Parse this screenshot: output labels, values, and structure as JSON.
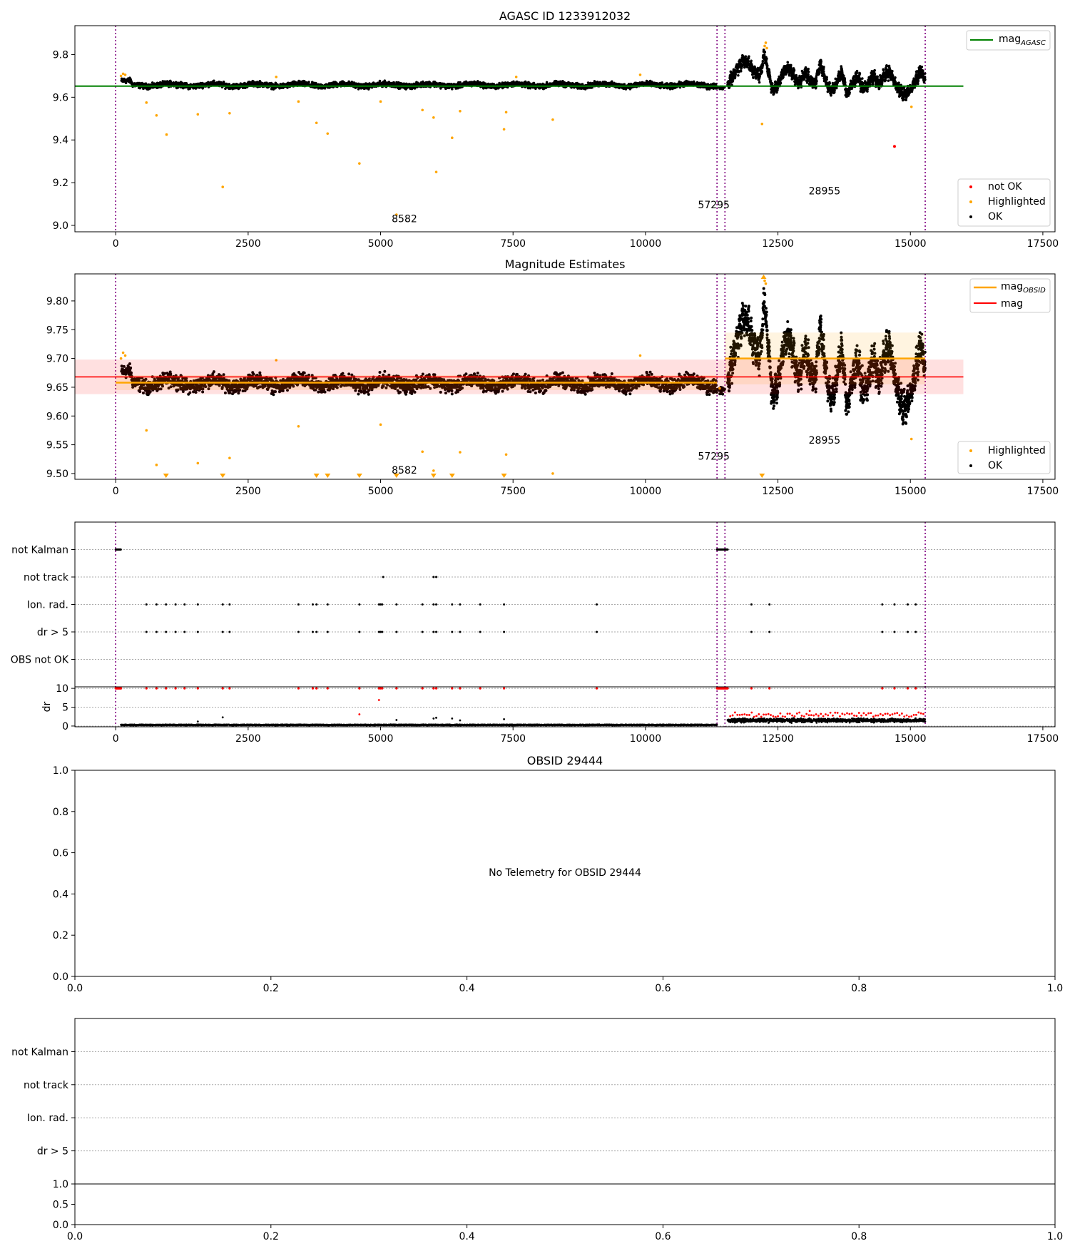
{
  "chart_data": [
    {
      "type": "scatter",
      "title": "AGASC ID 1233912032",
      "xlim": [
        -770,
        17730
      ],
      "ylim": [
        8.97,
        9.935
      ],
      "xticks": [
        0,
        2500,
        5000,
        7500,
        10000,
        12500,
        15000,
        17500
      ],
      "yticks": [
        9.0,
        9.2,
        9.4,
        9.6,
        9.8
      ],
      "obsid_boundaries": [
        0,
        11350,
        11500,
        15280
      ],
      "obsid_labels": [
        {
          "text": "8582",
          "x": 5450,
          "y": 9.015
        },
        {
          "text": "57295",
          "x": 11290,
          "y": 9.08
        },
        {
          "text": "28955",
          "x": 13380,
          "y": 9.145
        }
      ],
      "lines": [
        {
          "name": "mag_AGASC",
          "label": "mag",
          "subscript": "AGASC",
          "y": 9.652,
          "x": [
            -770,
            16000
          ],
          "color": "#008000"
        }
      ],
      "series": [
        {
          "name": "not OK",
          "color": "#ff0000",
          "points": [
            [
              14700,
              9.37
            ]
          ]
        },
        {
          "name": "Highlighted",
          "color": "#ffa500",
          "points": [
            [
              100,
              9.7
            ],
            [
              140,
              9.71
            ],
            [
              180,
              9.705
            ],
            [
              580,
              9.575
            ],
            [
              770,
              9.515
            ],
            [
              960,
              9.425
            ],
            [
              1550,
              9.52
            ],
            [
              2020,
              9.18
            ],
            [
              2150,
              9.525
            ],
            [
              3030,
              9.695
            ],
            [
              3450,
              9.58
            ],
            [
              3790,
              9.48
            ],
            [
              4000,
              9.43
            ],
            [
              4600,
              9.29
            ],
            [
              5000,
              9.58
            ],
            [
              5300,
              9.05
            ],
            [
              5790,
              9.54
            ],
            [
              6000,
              9.505
            ],
            [
              6050,
              9.25
            ],
            [
              6350,
              9.41
            ],
            [
              6500,
              9.535
            ],
            [
              7330,
              9.45
            ],
            [
              7370,
              9.53
            ],
            [
              7560,
              9.695
            ],
            [
              8250,
              9.495
            ],
            [
              9900,
              9.705
            ],
            [
              12200,
              9.475
            ],
            [
              12250,
              9.84
            ],
            [
              12270,
              9.855
            ],
            [
              12290,
              9.83
            ],
            [
              15020,
              9.555
            ]
          ]
        },
        {
          "name": "OK",
          "color": "#000000"
        }
      ],
      "legend": [
        "top-right",
        "bottom-right"
      ]
    },
    {
      "type": "scatter",
      "title": "Magnitude Estimates",
      "xlim": [
        -770,
        17730
      ],
      "ylim": [
        9.49,
        9.847
      ],
      "xticks": [
        0,
        2500,
        5000,
        7500,
        10000,
        12500,
        15000,
        17500
      ],
      "yticks": [
        9.5,
        9.55,
        9.6,
        9.65,
        9.7,
        9.75,
        9.8
      ],
      "obsid_boundaries": [
        0,
        11350,
        11500,
        15280
      ],
      "obsid_labels": [
        {
          "text": "8582",
          "x": 5450,
          "y": 9.5
        },
        {
          "text": "57295",
          "x": 11290,
          "y": 9.524
        },
        {
          "text": "28955",
          "x": 13380,
          "y": 9.552
        }
      ],
      "lines": [
        {
          "name": "mag_OBSID",
          "label": "mag",
          "subscript": "OBSID",
          "color": "#ffa500",
          "segments": [
            {
              "x": [
                0,
                11350
              ],
              "y": 9.658,
              "band": [
                9.645,
                9.671
              ]
            },
            {
              "x": [
                11500,
                15280
              ],
              "y": 9.7,
              "band": [
                9.655,
                9.745
              ]
            }
          ]
        },
        {
          "name": "mag",
          "label": "mag",
          "color": "#ff0000",
          "y": 9.668,
          "band": [
            9.638,
            9.698
          ],
          "x": [
            -770,
            16000
          ]
        }
      ],
      "series": [
        {
          "name": "Highlighted",
          "color": "#ffa500",
          "points": [
            [
              100,
              9.7
            ],
            [
              140,
              9.71
            ],
            [
              180,
              9.705
            ],
            [
              580,
              9.575
            ],
            [
              770,
              9.515
            ],
            [
              1550,
              9.518
            ],
            [
              2150,
              9.527
            ],
            [
              3030,
              9.697
            ],
            [
              3450,
              9.582
            ],
            [
              5000,
              9.585
            ],
            [
              5790,
              9.538
            ],
            [
              6000,
              9.505
            ],
            [
              6500,
              9.537
            ],
            [
              7370,
              9.533
            ],
            [
              8250,
              9.5
            ],
            [
              9900,
              9.705
            ],
            [
              11400,
              9.648
            ],
            [
              12250,
              9.835
            ],
            [
              12270,
              9.83
            ],
            [
              15020,
              9.56
            ]
          ]
        },
        {
          "name": "OK",
          "color": "#000000"
        }
      ],
      "below_range_markers": [
        950,
        2020,
        3790,
        4000,
        4600,
        5300,
        6000,
        6350,
        7330,
        12200
      ],
      "above_range_markers": [
        12230
      ],
      "legend": [
        "top-right",
        "bottom-right"
      ]
    },
    {
      "type": "scatter",
      "xlim": [
        -770,
        17730
      ],
      "xticks": [
        0,
        2500,
        5000,
        7500,
        10000,
        12500,
        15000,
        17500
      ],
      "flag_rows": [
        "OBS not OK",
        "dr > 5",
        "Ion. rad.",
        "not track",
        "not Kalman"
      ],
      "flags": {
        "not Kalman": [
          [
            0,
            100
          ],
          [
            11350,
            11550
          ]
        ],
        "not track": [
          5050,
          6000,
          6050
        ],
        "Ion. rad.": [
          580,
          770,
          950,
          1130,
          1300,
          1550,
          2020,
          2150,
          3450,
          3720,
          3790,
          4000,
          4600,
          4970,
          5000,
          5030,
          5300,
          5790,
          6000,
          6050,
          6350,
          6500,
          6880,
          7330,
          9080,
          12000,
          12340,
          14470,
          14700,
          14950,
          15100
        ],
        "dr > 5": [
          580,
          770,
          950,
          1130,
          1300,
          1550,
          2020,
          2150,
          3450,
          3720,
          3790,
          4000,
          4600,
          4970,
          5000,
          5030,
          5300,
          5790,
          6000,
          6050,
          6350,
          6500,
          6880,
          7330,
          9080,
          12000,
          12340,
          14470,
          14700,
          14950,
          15100
        ],
        "OBS not OK": []
      },
      "dr": {
        "ylabel": "dr",
        "ylim": [
          -0.2,
          10.4
        ],
        "yticks": [
          0,
          5,
          10
        ],
        "levels": [
          {
            "x": [
              100,
              11350
            ],
            "y": 0.3
          },
          {
            "x": [
              11550,
              15280
            ],
            "y": 1.5
          }
        ],
        "outliers": [
          [
            2020,
            2.3
          ],
          [
            1550,
            1.2
          ],
          [
            4600,
            3.1
          ],
          [
            4970,
            6.9
          ],
          [
            5300,
            1.6
          ],
          [
            6000,
            2.0
          ],
          [
            6050,
            2.2
          ],
          [
            6350,
            2.0
          ],
          [
            6500,
            1.5
          ],
          [
            7330,
            1.8
          ],
          [
            13100,
            4.0
          ]
        ],
        "clipped_at": 10
      }
    },
    {
      "type": "scatter",
      "title": "OBSID 29444",
      "message": "No Telemetry for OBSID 29444",
      "xlim": [
        0,
        1
      ],
      "ylim": [
        0,
        1
      ],
      "xticks": [
        0.0,
        0.2,
        0.4,
        0.6,
        0.8,
        1.0
      ],
      "yticks": [
        0.0,
        0.2,
        0.4,
        0.6,
        0.8,
        1.0
      ]
    },
    {
      "type": "scatter",
      "flag_rows": [
        "dr > 5",
        "Ion. rad.",
        "not track",
        "not Kalman"
      ],
      "sub_yticks": [
        0.0,
        0.5,
        1.0
      ],
      "xticks": [
        0.0,
        0.2,
        0.4,
        0.6,
        0.8,
        1.0
      ]
    }
  ],
  "legend_labels": {
    "not_ok": "not OK",
    "highlighted": "Highlighted",
    "ok": "OK",
    "mag": "mag",
    "agasc": "AGASC",
    "obsid": "OBSID"
  }
}
